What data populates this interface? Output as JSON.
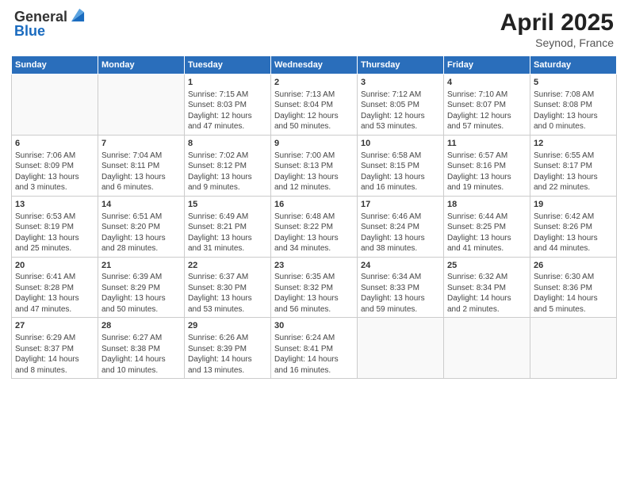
{
  "header": {
    "logo_general": "General",
    "logo_blue": "Blue",
    "title": "April 2025",
    "subtitle": "Seynod, France"
  },
  "weekdays": [
    "Sunday",
    "Monday",
    "Tuesday",
    "Wednesday",
    "Thursday",
    "Friday",
    "Saturday"
  ],
  "weeks": [
    [
      {
        "day": "",
        "info": ""
      },
      {
        "day": "",
        "info": ""
      },
      {
        "day": "1",
        "info": "Sunrise: 7:15 AM\nSunset: 8:03 PM\nDaylight: 12 hours\nand 47 minutes."
      },
      {
        "day": "2",
        "info": "Sunrise: 7:13 AM\nSunset: 8:04 PM\nDaylight: 12 hours\nand 50 minutes."
      },
      {
        "day": "3",
        "info": "Sunrise: 7:12 AM\nSunset: 8:05 PM\nDaylight: 12 hours\nand 53 minutes."
      },
      {
        "day": "4",
        "info": "Sunrise: 7:10 AM\nSunset: 8:07 PM\nDaylight: 12 hours\nand 57 minutes."
      },
      {
        "day": "5",
        "info": "Sunrise: 7:08 AM\nSunset: 8:08 PM\nDaylight: 13 hours\nand 0 minutes."
      }
    ],
    [
      {
        "day": "6",
        "info": "Sunrise: 7:06 AM\nSunset: 8:09 PM\nDaylight: 13 hours\nand 3 minutes."
      },
      {
        "day": "7",
        "info": "Sunrise: 7:04 AM\nSunset: 8:11 PM\nDaylight: 13 hours\nand 6 minutes."
      },
      {
        "day": "8",
        "info": "Sunrise: 7:02 AM\nSunset: 8:12 PM\nDaylight: 13 hours\nand 9 minutes."
      },
      {
        "day": "9",
        "info": "Sunrise: 7:00 AM\nSunset: 8:13 PM\nDaylight: 13 hours\nand 12 minutes."
      },
      {
        "day": "10",
        "info": "Sunrise: 6:58 AM\nSunset: 8:15 PM\nDaylight: 13 hours\nand 16 minutes."
      },
      {
        "day": "11",
        "info": "Sunrise: 6:57 AM\nSunset: 8:16 PM\nDaylight: 13 hours\nand 19 minutes."
      },
      {
        "day": "12",
        "info": "Sunrise: 6:55 AM\nSunset: 8:17 PM\nDaylight: 13 hours\nand 22 minutes."
      }
    ],
    [
      {
        "day": "13",
        "info": "Sunrise: 6:53 AM\nSunset: 8:19 PM\nDaylight: 13 hours\nand 25 minutes."
      },
      {
        "day": "14",
        "info": "Sunrise: 6:51 AM\nSunset: 8:20 PM\nDaylight: 13 hours\nand 28 minutes."
      },
      {
        "day": "15",
        "info": "Sunrise: 6:49 AM\nSunset: 8:21 PM\nDaylight: 13 hours\nand 31 minutes."
      },
      {
        "day": "16",
        "info": "Sunrise: 6:48 AM\nSunset: 8:22 PM\nDaylight: 13 hours\nand 34 minutes."
      },
      {
        "day": "17",
        "info": "Sunrise: 6:46 AM\nSunset: 8:24 PM\nDaylight: 13 hours\nand 38 minutes."
      },
      {
        "day": "18",
        "info": "Sunrise: 6:44 AM\nSunset: 8:25 PM\nDaylight: 13 hours\nand 41 minutes."
      },
      {
        "day": "19",
        "info": "Sunrise: 6:42 AM\nSunset: 8:26 PM\nDaylight: 13 hours\nand 44 minutes."
      }
    ],
    [
      {
        "day": "20",
        "info": "Sunrise: 6:41 AM\nSunset: 8:28 PM\nDaylight: 13 hours\nand 47 minutes."
      },
      {
        "day": "21",
        "info": "Sunrise: 6:39 AM\nSunset: 8:29 PM\nDaylight: 13 hours\nand 50 minutes."
      },
      {
        "day": "22",
        "info": "Sunrise: 6:37 AM\nSunset: 8:30 PM\nDaylight: 13 hours\nand 53 minutes."
      },
      {
        "day": "23",
        "info": "Sunrise: 6:35 AM\nSunset: 8:32 PM\nDaylight: 13 hours\nand 56 minutes."
      },
      {
        "day": "24",
        "info": "Sunrise: 6:34 AM\nSunset: 8:33 PM\nDaylight: 13 hours\nand 59 minutes."
      },
      {
        "day": "25",
        "info": "Sunrise: 6:32 AM\nSunset: 8:34 PM\nDaylight: 14 hours\nand 2 minutes."
      },
      {
        "day": "26",
        "info": "Sunrise: 6:30 AM\nSunset: 8:36 PM\nDaylight: 14 hours\nand 5 minutes."
      }
    ],
    [
      {
        "day": "27",
        "info": "Sunrise: 6:29 AM\nSunset: 8:37 PM\nDaylight: 14 hours\nand 8 minutes."
      },
      {
        "day": "28",
        "info": "Sunrise: 6:27 AM\nSunset: 8:38 PM\nDaylight: 14 hours\nand 10 minutes."
      },
      {
        "day": "29",
        "info": "Sunrise: 6:26 AM\nSunset: 8:39 PM\nDaylight: 14 hours\nand 13 minutes."
      },
      {
        "day": "30",
        "info": "Sunrise: 6:24 AM\nSunset: 8:41 PM\nDaylight: 14 hours\nand 16 minutes."
      },
      {
        "day": "",
        "info": ""
      },
      {
        "day": "",
        "info": ""
      },
      {
        "day": "",
        "info": ""
      }
    ]
  ]
}
